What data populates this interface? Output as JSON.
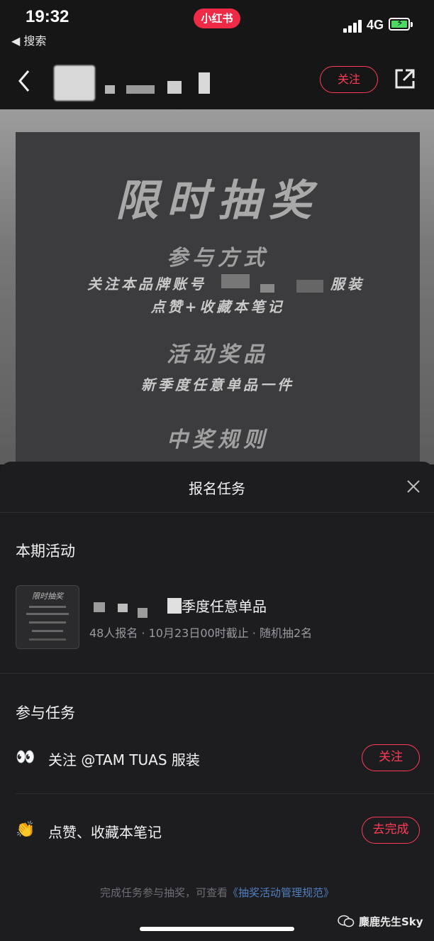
{
  "status_bar": {
    "time": "19:32",
    "back_app_label": "◀ 搜索",
    "app_badge": "小红书",
    "network": "4G"
  },
  "nav": {
    "follow_label": "关注",
    "icons": [
      "chevron-left-icon",
      "share-icon"
    ]
  },
  "poster": {
    "title": "限时抽奖",
    "join_heading": "参与方式",
    "join_line1": "关注本品牌账号",
    "join_line1_end": "服装",
    "join_line2": "点赞+收藏本笔记",
    "prize_heading": "活动奖品",
    "prize_text": "新季度任意单品一件",
    "rule_heading": "中奖规则"
  },
  "sheet": {
    "title": "报名任务",
    "current_section": "本期活动",
    "activity": {
      "title": "季度任意单品",
      "meta": "48人报名 · 10月23日00时截止 · 随机抽2名",
      "thumb_title": "限时抽奖"
    },
    "tasks_section": "参与任务",
    "tasks": [
      {
        "icon": "eyes-icon",
        "label": "关注 @TAM TUAS 服装",
        "button": "关注"
      },
      {
        "icon": "clapping-hands-icon",
        "label": "点赞、收藏本笔记",
        "button": "去完成"
      }
    ],
    "footer_prefix": "完成任务参与抽奖，可查看",
    "footer_link": "《抽奖活动管理规范》"
  },
  "watermark": "麋鹿先生Sky",
  "colors": {
    "accent": "#ff3b56",
    "link": "#4f7fbf",
    "badge": "#ef2a46"
  }
}
